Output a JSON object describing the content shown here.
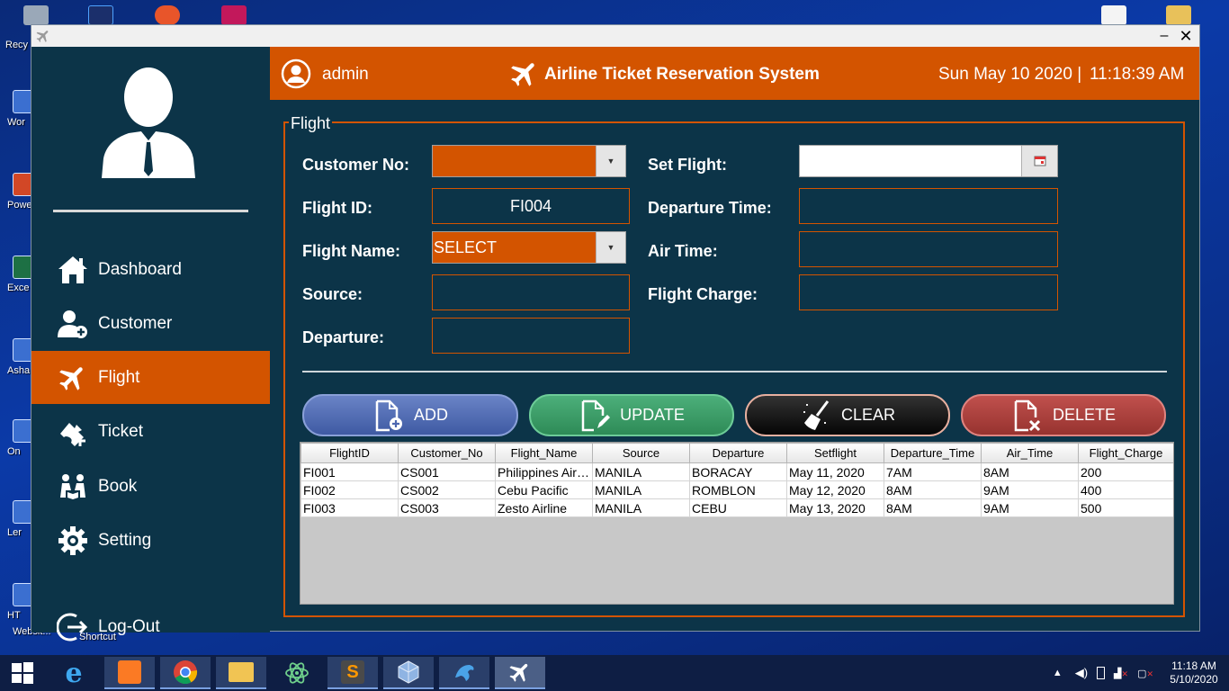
{
  "desktop": {
    "icons": [
      {
        "name": "recycle-bin",
        "label": "Recy"
      },
      {
        "name": "word",
        "label": "Wor"
      },
      {
        "name": "powerpoint",
        "label": "Powe"
      },
      {
        "name": "excel",
        "label": "Exce"
      },
      {
        "name": "asha",
        "label": "Asha"
      },
      {
        "name": "onerec",
        "label": "On"
      },
      {
        "name": "lenovo",
        "label": "Ler"
      },
      {
        "name": "html-website",
        "label": "HT"
      }
    ],
    "shortcut_label": "Shortcut",
    "website_label": "Websit..."
  },
  "window": {
    "minimize": "–",
    "close": "✕"
  },
  "sidebar": {
    "items": [
      {
        "label": "Dashboard",
        "icon": "home-icon"
      },
      {
        "label": "Customer",
        "icon": "add-user-icon"
      },
      {
        "label": "Flight",
        "icon": "plane-icon",
        "active": true
      },
      {
        "label": "Ticket",
        "icon": "ticket-plane-icon"
      },
      {
        "label": "Book",
        "icon": "book-reading-icon"
      },
      {
        "label": "Setting",
        "icon": "gear-icon"
      }
    ],
    "logout_label": "Log-Out"
  },
  "header": {
    "user": "admin",
    "title": "Airline Ticket Reservation System",
    "date": "Sun May 10 2020 |",
    "time": "11:18:39 AM"
  },
  "form": {
    "legend": "Flight",
    "customer_no_label": "Customer No:",
    "customer_no_value": "",
    "flight_id_label": "Flight ID:",
    "flight_id_value": "FI004",
    "flight_name_label": "Flight Name:",
    "flight_name_value": "SELECT",
    "source_label": "Source:",
    "source_value": "",
    "departure_label": "Departure:",
    "departure_value": "",
    "set_flight_label": "Set Flight:",
    "set_flight_value": "",
    "departure_time_label": "Departure Time:",
    "departure_time_value": "",
    "air_time_label": "Air Time:",
    "air_time_value": "",
    "flight_charge_label": "Flight Charge:",
    "flight_charge_value": ""
  },
  "buttons": {
    "add": "ADD",
    "update": "UPDATE",
    "clear": "CLEAR",
    "delete": "DELETE"
  },
  "table": {
    "columns": [
      "FlightID",
      "Customer_No",
      "Flight_Name",
      "Source",
      "Departure",
      "Setflight",
      "Departure_Time",
      "Air_Time",
      "Flight_Charge"
    ],
    "rows": [
      [
        "FI001",
        "CS001",
        "Philippines Airli...",
        "MANILA",
        "BORACAY",
        "May 11, 2020",
        "7AM",
        "8AM",
        "200"
      ],
      [
        "FI002",
        "CS002",
        "Cebu Pacific",
        "MANILA",
        "ROMBLON",
        "May 12, 2020",
        "8AM",
        "9AM",
        "400"
      ],
      [
        "FI003",
        "CS003",
        "Zesto Airline",
        "MANILA",
        "CEBU",
        "May 13, 2020",
        "8AM",
        "9AM",
        "500"
      ]
    ]
  },
  "taskbar": {
    "clock_time": "11:18 AM",
    "clock_date": "5/10/2020"
  },
  "colors": {
    "accent": "#d35400",
    "panel": "#0c3448"
  }
}
